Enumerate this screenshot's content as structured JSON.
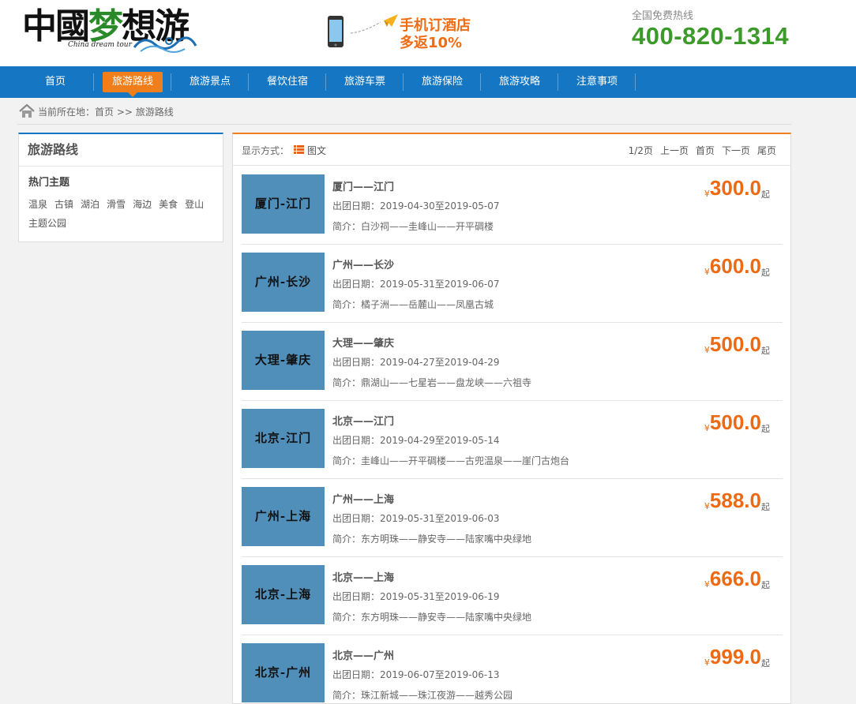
{
  "header": {
    "logo_text": "中國梦想游",
    "logo_en": "China dream tour",
    "promo_line1": "手机订酒店",
    "promo_line2": "多返10%",
    "hotline_label": "全国免费热线",
    "hotline_number": "400-820-1314"
  },
  "nav": {
    "items": [
      {
        "label": "首页"
      },
      {
        "label": "旅游路线",
        "active": true
      },
      {
        "label": "旅游景点"
      },
      {
        "label": "餐饮住宿"
      },
      {
        "label": "旅游车票"
      },
      {
        "label": "旅游保险"
      },
      {
        "label": "旅游攻略"
      },
      {
        "label": "注意事项"
      }
    ],
    "active_color": "#f07e1b",
    "bar_color": "#1577c3"
  },
  "breadcrumb": {
    "prefix": "当前所在地：",
    "home": "首页",
    "sep": ">>",
    "current": "旅游路线"
  },
  "sidebar": {
    "title": "旅游路线",
    "subtitle": "热门主题",
    "tags": [
      "温泉",
      "古镇",
      "湖泊",
      "滑雪",
      "海边",
      "美食",
      "登山",
      "主题公园"
    ]
  },
  "toolbar": {
    "display_label": "显示方式：",
    "display_mode": "图文",
    "page_info": "1/2页",
    "prev": "上一页",
    "first": "首页",
    "next": "下一页",
    "last": "尾页"
  },
  "labels": {
    "date_prefix": "出团日期：",
    "desc_prefix": "简介：",
    "yen": "¥",
    "qi": "起"
  },
  "routes": [
    {
      "thumb": "厦门-江门",
      "title": "厦门——江门",
      "date": "2019-04-30至2019-05-07",
      "desc": "白沙祠——圭峰山——开平碉楼",
      "price": "300.0"
    },
    {
      "thumb": "广州-长沙",
      "title": "广州——长沙",
      "date": "2019-05-31至2019-06-07",
      "desc": "橘子洲——岳麓山——凤凰古城",
      "price": "600.0"
    },
    {
      "thumb": "大理-肇庆",
      "title": "大理——肇庆",
      "date": "2019-04-27至2019-04-29",
      "desc": "鼎湖山——七星岩——盘龙峡——六祖寺",
      "price": "500.0"
    },
    {
      "thumb": "北京-江门",
      "title": "北京——江门",
      "date": "2019-04-29至2019-05-14",
      "desc": "圭峰山——开平碉楼——古兜温泉——崖门古炮台",
      "price": "500.0"
    },
    {
      "thumb": "广州-上海",
      "title": "广州——上海",
      "date": "2019-05-31至2019-06-03",
      "desc": "东方明珠——静安寺——陆家嘴中央绿地",
      "price": "588.0"
    },
    {
      "thumb": "北京-上海",
      "title": "北京——上海",
      "date": "2019-05-31至2019-06-19",
      "desc": "东方明珠——静安寺——陆家嘴中央绿地",
      "price": "666.0"
    },
    {
      "thumb": "北京-广州",
      "title": "北京——广州",
      "date": "2019-06-07至2019-06-13",
      "desc": "珠江新城——珠江夜游——越秀公园",
      "price": "999.0"
    }
  ]
}
